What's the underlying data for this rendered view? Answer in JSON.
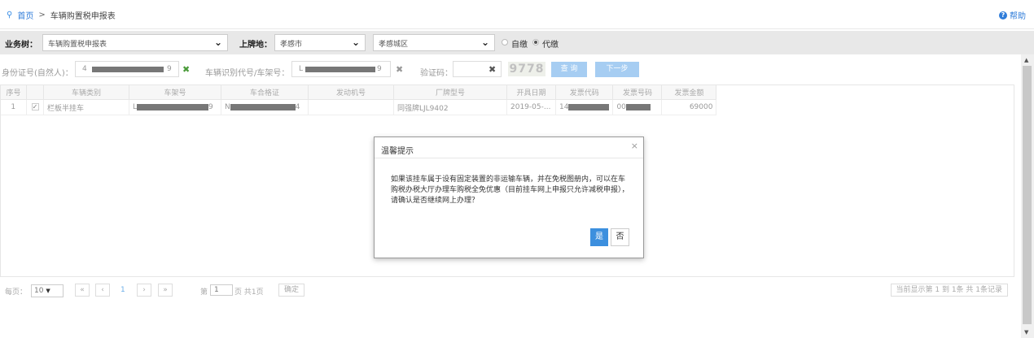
{
  "breadcrumb": {
    "home": "首页",
    "separator": ">",
    "current": "车辆购置税申报表"
  },
  "help_label": "帮助",
  "biz": {
    "tree_label": "业务树：",
    "tree_value": "车辆购置税申报表",
    "plate_label": "上牌地：",
    "city_value": "孝感市",
    "district_value": "孝感城区",
    "options": [
      "自缴",
      "代缴"
    ],
    "selected_option": "代缴"
  },
  "query": {
    "id_label": "身份证号(自然人)：",
    "id_prefix": "4",
    "id_suffix": "9",
    "vin_label": "车辆识别代号/车架号：",
    "vin_prefix": "L",
    "vin_suffix": "9",
    "captcha_label": "验证码：",
    "captcha_image_text": "9778",
    "query_button": "查 询",
    "next_button": "下一步"
  },
  "table": {
    "columns": [
      "序号",
      "",
      "车辆类别",
      "车架号",
      "车合格证",
      "发动机号",
      "厂牌型号",
      "开具日期",
      "发票代码",
      "发票号码",
      "发票金额"
    ],
    "rows": [
      {
        "index": "1",
        "checked": true,
        "category": "栏板半挂车",
        "vin_prefix": "L",
        "vin_suffix": "9",
        "cert_prefix": "N",
        "cert_suffix": "4",
        "engine": "",
        "model": "同强牌LJL9402",
        "date": "2019-05-...",
        "invoice_code_prefix": "14",
        "invoice_no_prefix": "00",
        "amount": "69000"
      }
    ]
  },
  "pager": {
    "per_page_label": "每页：",
    "per_page": "10",
    "first": "«",
    "prev": "‹",
    "current": "1",
    "next": "›",
    "last": "»",
    "page_prefix": "第",
    "page_value": "1",
    "page_suffix": "页 共1页",
    "confirm": "确定",
    "record_info": "当前显示第  1 到  1条 共  1条记录"
  },
  "dialog": {
    "title": "温馨提示",
    "message": "如果该挂车属于设有固定装置的非运输车辆，并在免税图册内，可以在车购税办税大厅办理车购税全免优惠（目前挂车网上申报只允许减税申报），请确认是否继续网上办理？",
    "yes": "是",
    "no": "否"
  },
  "colors": {
    "accent": "#3c8fde",
    "link": "#2f7cd9",
    "bizbar": "#e8e8e8"
  }
}
